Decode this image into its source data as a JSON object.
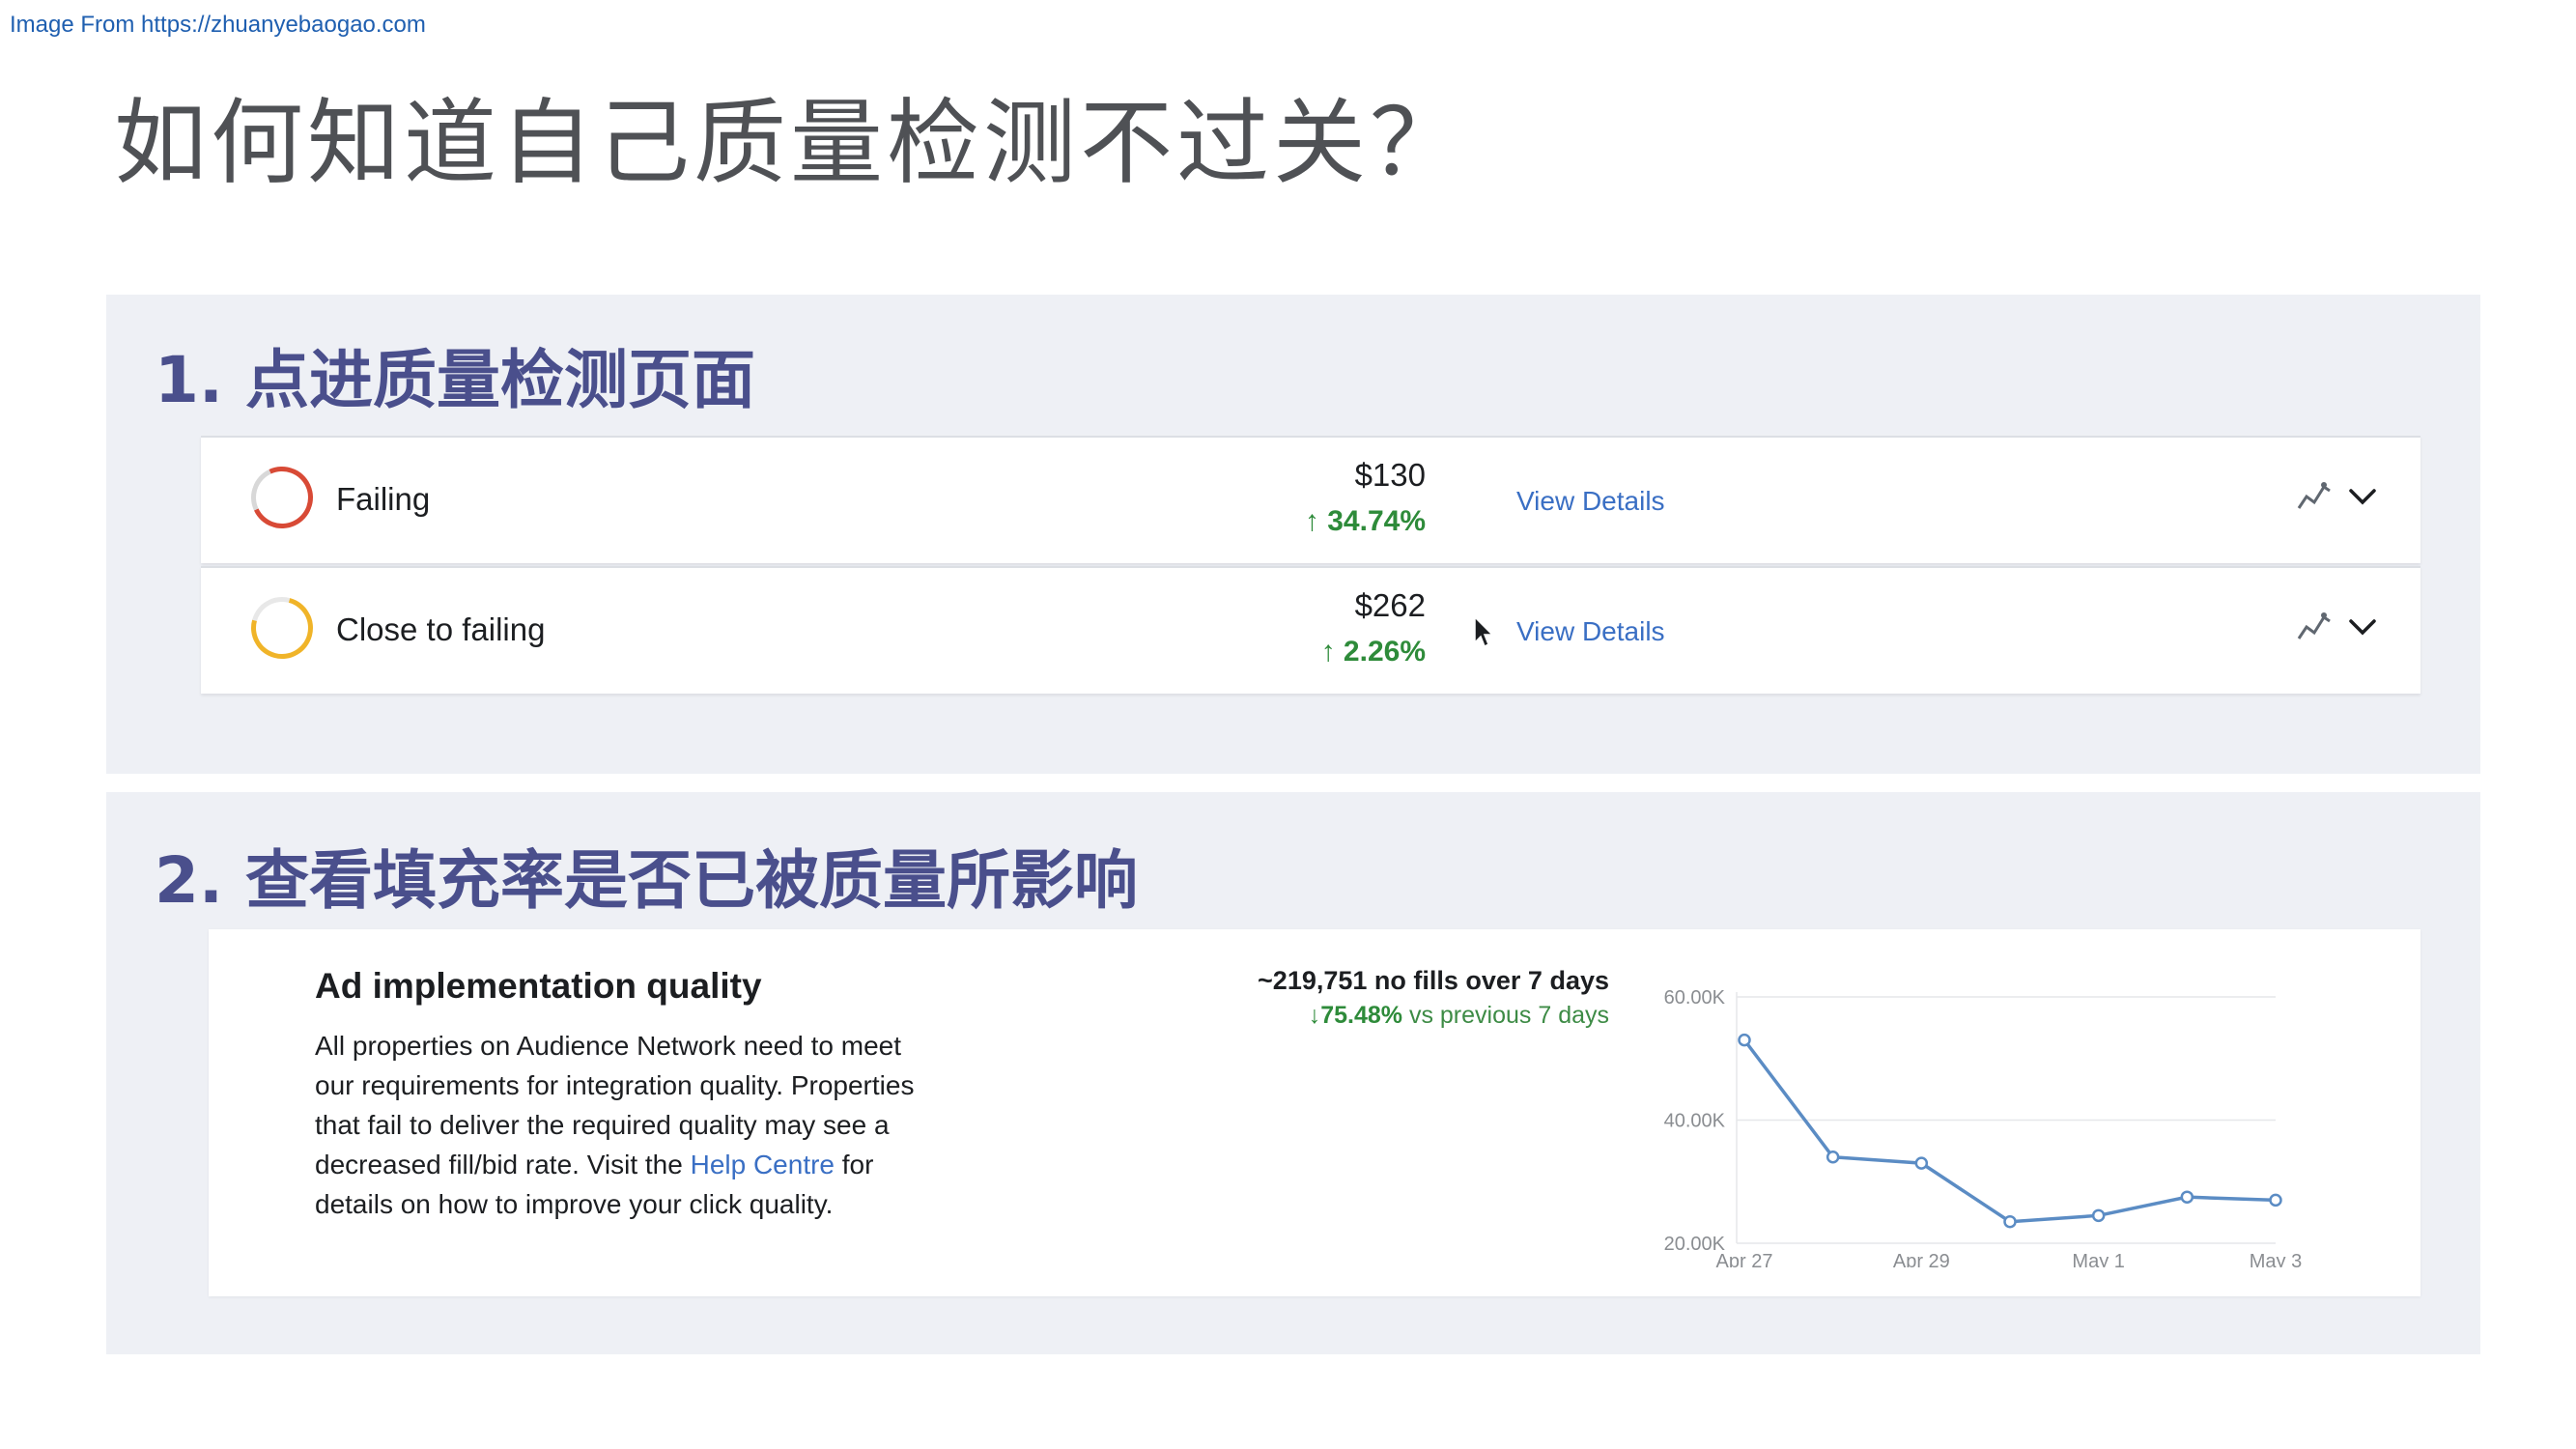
{
  "source": {
    "text": "Image From https://zhuanyebaogao.com"
  },
  "title": "如何知道自己质量检测不过关？",
  "step1": {
    "heading": "1. 点进质量检测页面",
    "rows": [
      {
        "status": "Failing",
        "amount": "$130",
        "change": "↑ 34.74%",
        "link": "View Details",
        "ring_color": "#d84a36"
      },
      {
        "status": "Close to failing",
        "amount": "$262",
        "change": "↑ 2.26%",
        "link": "View Details",
        "ring_color": "#f0b429"
      }
    ]
  },
  "step2": {
    "heading": "2. 查看填充率是否已被质量所影响",
    "card": {
      "title": "Ad implementation quality",
      "desc_before": "All properties on Audience Network need to meet our requirements for integration quality. Properties that fail to deliver the required quality may see a decreased fill/bid rate. Visit the ",
      "desc_link": "Help Centre",
      "desc_after": " for details on how to improve your click quality.",
      "summary_main": "~219,751 no fills over 7 days",
      "summary_pct": "↓75.48%",
      "summary_vs": "vs previous 7 days"
    }
  },
  "chart_data": {
    "type": "line",
    "x": [
      "Apr 27",
      "Apr 28",
      "Apr 29",
      "Apr 30",
      "May 1",
      "May 2",
      "May 3"
    ],
    "x_tick_labels": [
      "Apr 27",
      "Apr 29",
      "May 1",
      "May 3"
    ],
    "y_tick_labels": [
      "60.00K",
      "40.00K",
      "20.00K"
    ],
    "series": [
      {
        "values": [
          53000,
          34000,
          33000,
          23500,
          24500,
          27500,
          27000
        ]
      }
    ],
    "ylim": [
      20000,
      60000
    ],
    "grid": true,
    "line_color": "#5b8cc4"
  }
}
